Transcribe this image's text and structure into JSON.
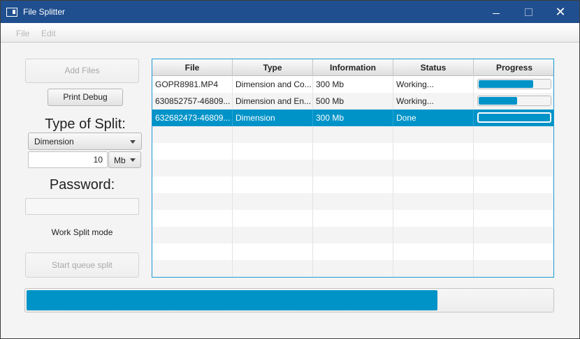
{
  "window": {
    "title": "File Splitter",
    "close_symbol": "✕"
  },
  "menu": [
    "File",
    "Edit"
  ],
  "left_panel": {
    "add_files": "Add Files",
    "print_debug": "Print Debug",
    "type_of_split_label": "Type of Split:",
    "split_type_selected": "Dimension",
    "size_value": "10",
    "size_unit": "Mb",
    "password_label": "Password:",
    "password_value": "",
    "mode_label": "Work Split mode",
    "start_button": "Start queue split"
  },
  "table": {
    "columns": [
      "File",
      "Type",
      "Information",
      "Status",
      "Progress"
    ],
    "rows": [
      {
        "file": "GOPR8981.MP4",
        "type": "Dimension and Co...",
        "info": "300 Mb",
        "status": "Working...",
        "progress": 0.75
      },
      {
        "file": "630852757-46809...",
        "type": "Dimension and En...",
        "info": "500 Mb",
        "status": "Working...",
        "progress": 0.53
      },
      {
        "file": "632682473-46809...",
        "type": "Dimension",
        "info": "300 Mb",
        "status": "Done",
        "progress": 1.0
      }
    ],
    "selected_row": 2
  },
  "overall_progress": 0.78,
  "colors": {
    "accent": "#0093c8",
    "titlebar": "#1f4f8e",
    "table_border": "#1d9bd6"
  }
}
